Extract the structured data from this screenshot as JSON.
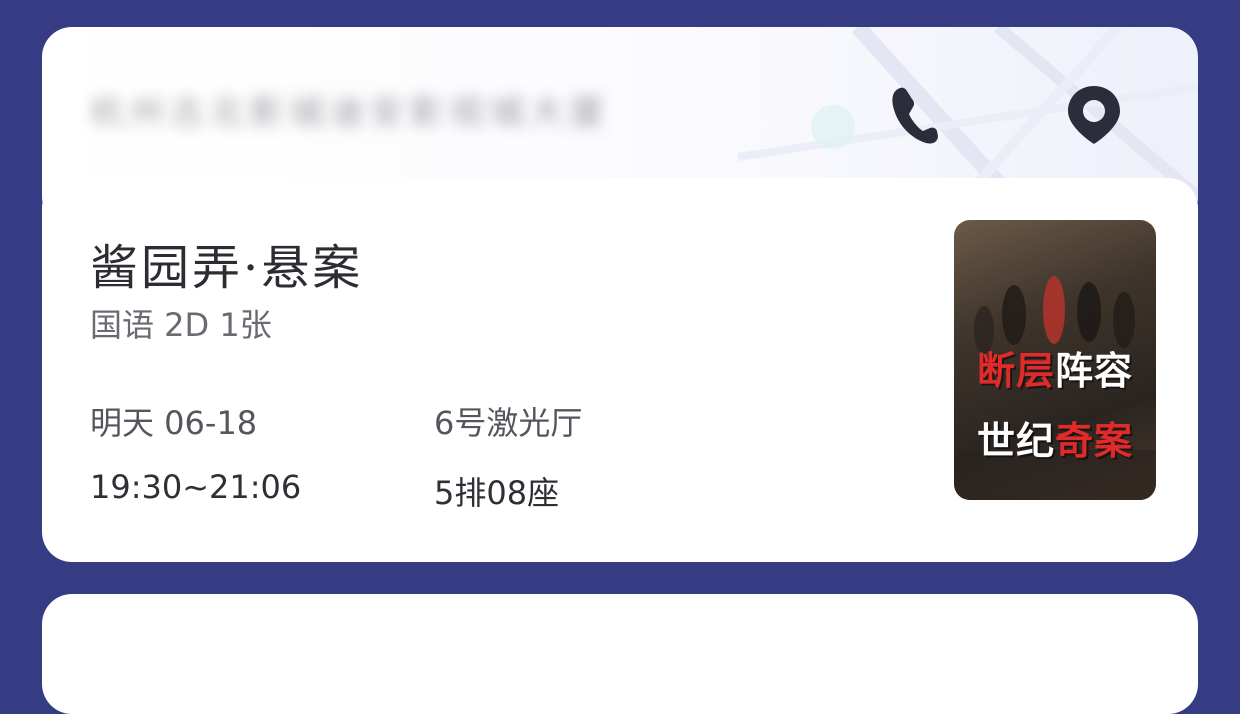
{
  "cinema": {
    "name": "杭州古北影城迪安影视城大厦",
    "phone_icon": "phone-icon",
    "location_icon": "location-pin-icon"
  },
  "ticket": {
    "movie_title": "酱园弄·悬案",
    "meta": "国语 2D 1张",
    "date": "明天 06-18",
    "time": "19:30~21:06",
    "hall": "6号激光厅",
    "seat": "5排08座"
  },
  "poster": {
    "line1_a": "断层",
    "line1_b": "阵容",
    "line2_a": "世纪",
    "line2_b": "奇案"
  },
  "colors": {
    "background": "#363c84",
    "card": "#ffffff",
    "icon": "#2b2e3a",
    "poster_accent": "#e12a2a"
  }
}
